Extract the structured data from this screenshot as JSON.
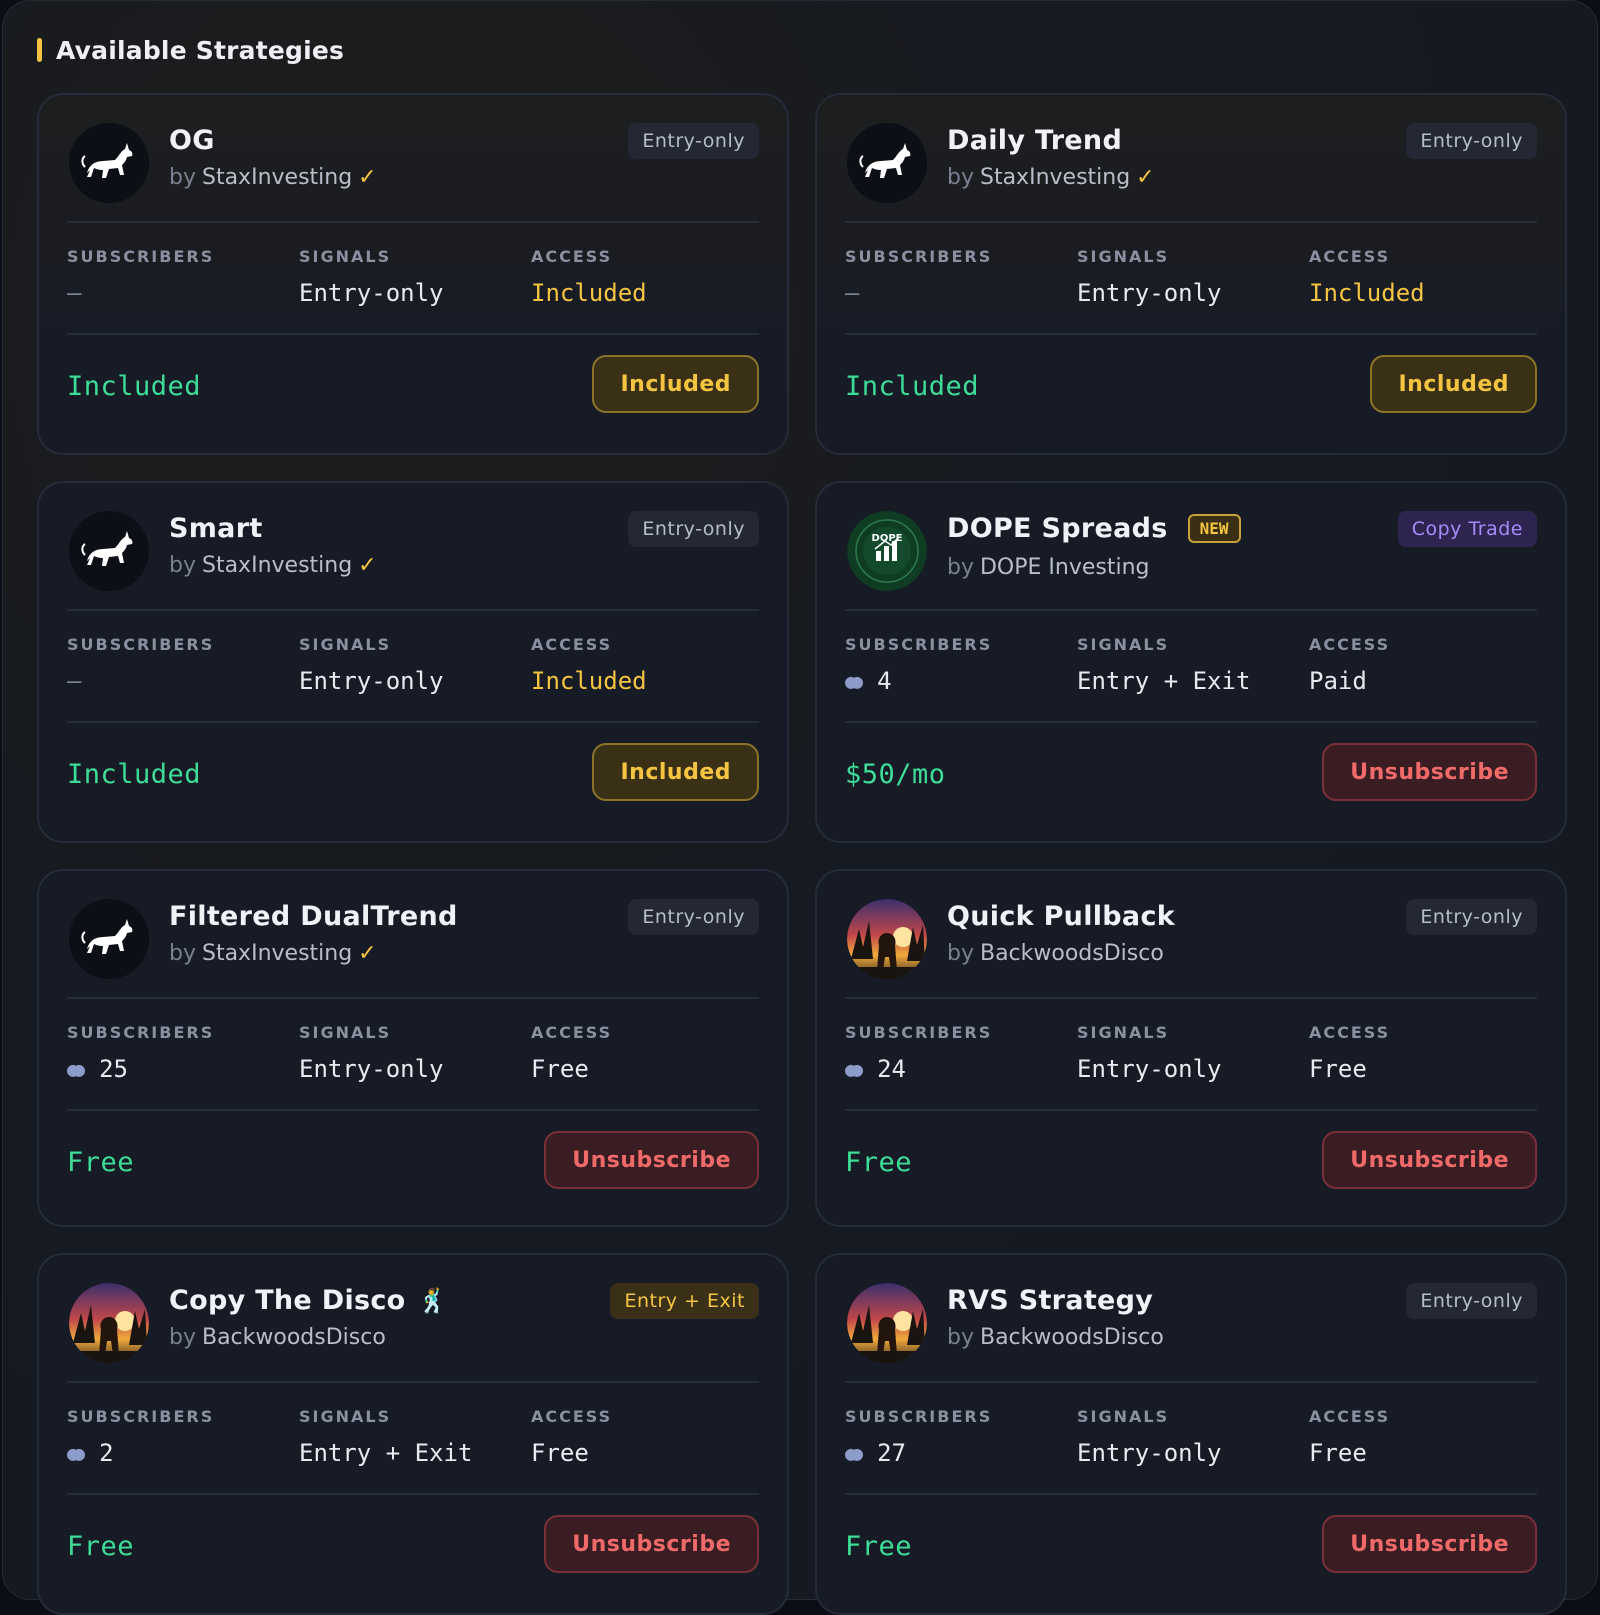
{
  "section": {
    "title": "Available Strategies"
  },
  "labels": {
    "subscribers": "SUBSCRIBERS",
    "signals": "SIGNALS",
    "access": "ACCESS",
    "by": "by"
  },
  "colors": {
    "accent": "#f5c542",
    "price": "#3ddc97",
    "danger": "#f06a6a",
    "purple": "#a78bfa"
  },
  "cards": [
    {
      "name": "OG",
      "author": "StaxInvesting",
      "verified": true,
      "tag": "Entry-only",
      "subscribers": "—",
      "signals": "Entry-only",
      "access": "Included",
      "price": "Included",
      "button": "Included",
      "avatar": "bull-icon"
    },
    {
      "name": "Daily Trend",
      "author": "StaxInvesting",
      "verified": true,
      "tag": "Entry-only",
      "subscribers": "—",
      "signals": "Entry-only",
      "access": "Included",
      "price": "Included",
      "button": "Included",
      "avatar": "bull-icon"
    },
    {
      "name": "Smart",
      "author": "StaxInvesting",
      "verified": true,
      "tag": "Entry-only",
      "subscribers": "—",
      "signals": "Entry-only",
      "access": "Included",
      "price": "Included",
      "button": "Included",
      "avatar": "bull-icon"
    },
    {
      "name": "DOPE Spreads",
      "badge": "NEW",
      "author": "DOPE Investing",
      "verified": false,
      "tag": "Copy Trade",
      "subscribers": "4",
      "signals": "Entry + Exit",
      "access": "Paid",
      "price": "$50/mo",
      "button": "Unsubscribe",
      "avatar": "dope-logo"
    },
    {
      "name": "Filtered DualTrend",
      "author": "StaxInvesting",
      "verified": true,
      "tag": "Entry-only",
      "subscribers": "25",
      "signals": "Entry-only",
      "access": "Free",
      "price": "Free",
      "button": "Unsubscribe",
      "avatar": "bull-icon"
    },
    {
      "name": "Quick Pullback",
      "author": "BackwoodsDisco",
      "verified": false,
      "tag": "Entry-only",
      "subscribers": "24",
      "signals": "Entry-only",
      "access": "Free",
      "price": "Free",
      "button": "Unsubscribe",
      "avatar": "bigfoot-sunset"
    },
    {
      "name": "Copy The Disco",
      "emoji": "🕺",
      "author": "BackwoodsDisco",
      "verified": false,
      "tag": "Entry + Exit",
      "subscribers": "2",
      "signals": "Entry + Exit",
      "access": "Free",
      "price": "Free",
      "button": "Unsubscribe",
      "avatar": "bigfoot-sunset"
    },
    {
      "name": "RVS Strategy",
      "author": "BackwoodsDisco",
      "verified": false,
      "tag": "Entry-only",
      "subscribers": "27",
      "signals": "Entry-only",
      "access": "Free",
      "price": "Free",
      "button": "Unsubscribe",
      "avatar": "bigfoot-sunset"
    }
  ],
  "dope_logo_text": "DOPE"
}
